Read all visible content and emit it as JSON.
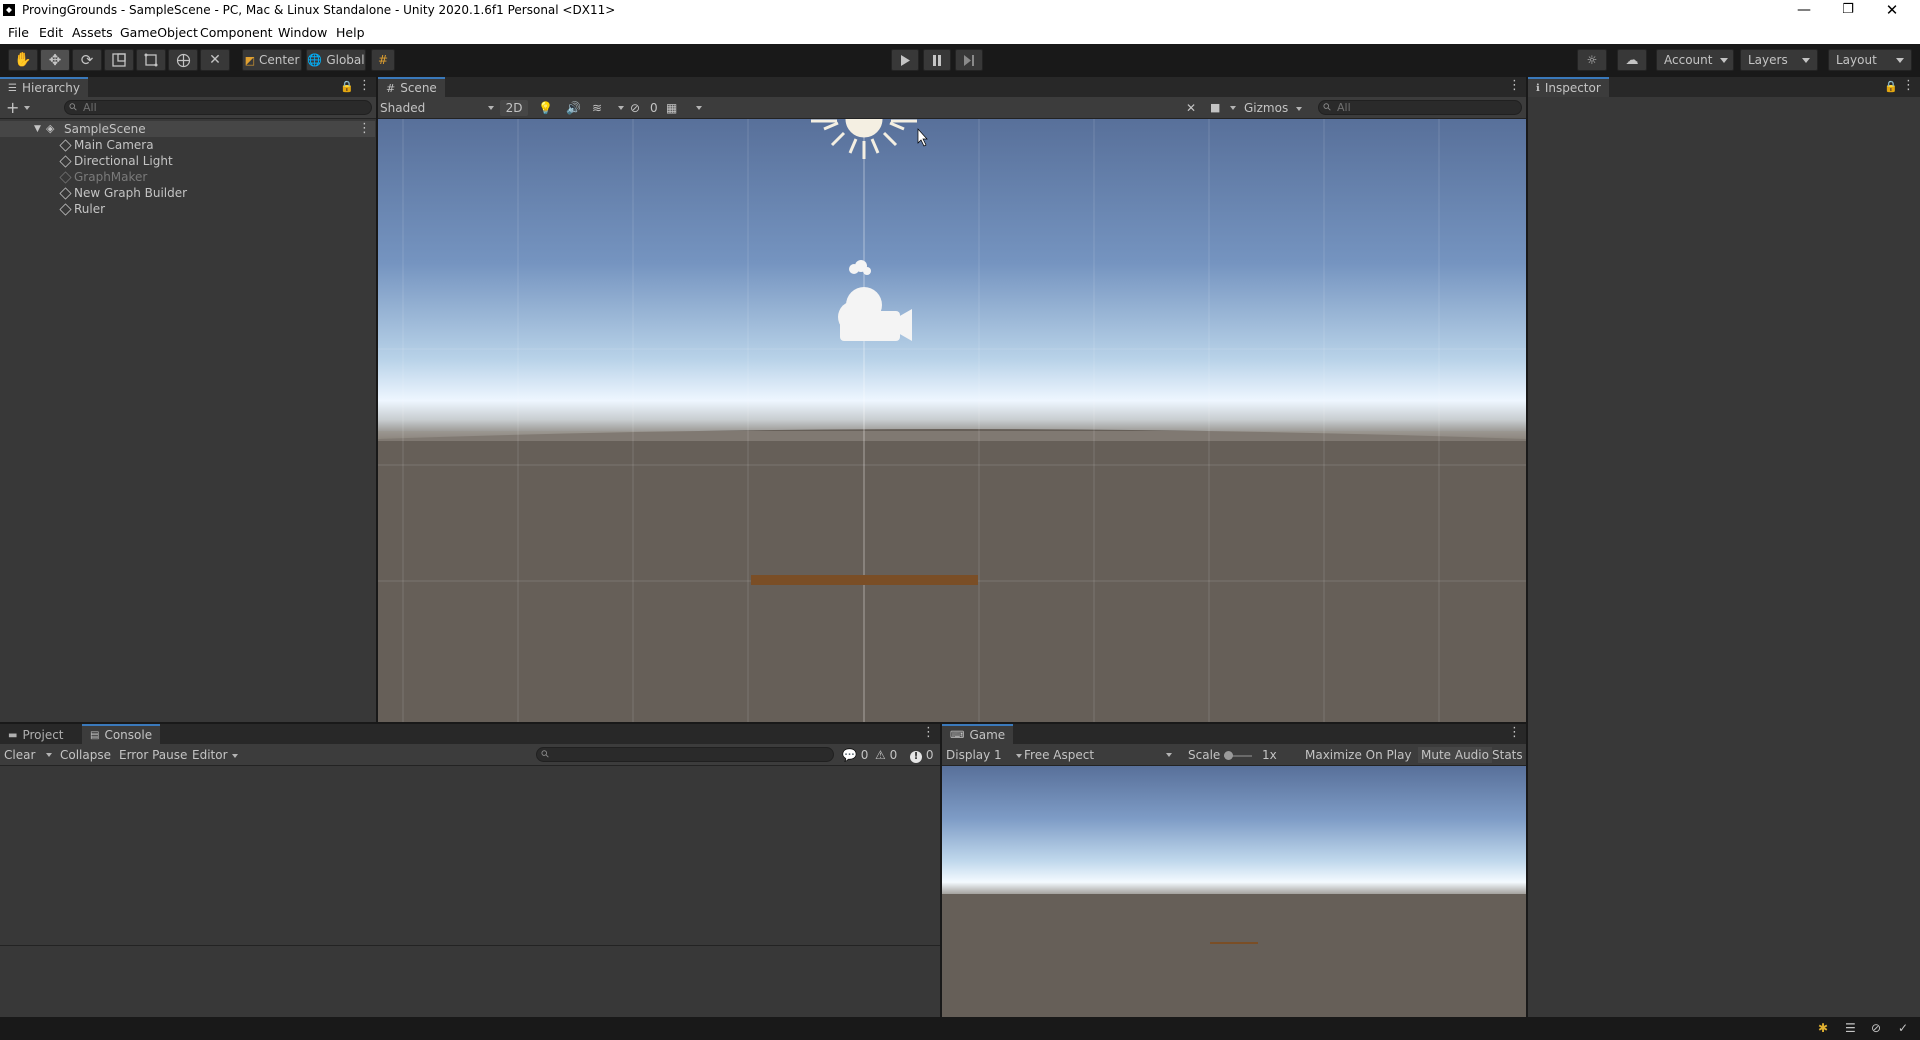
{
  "window": {
    "title": "ProvingGrounds - SampleScene - PC, Mac & Linux Standalone - Unity 2020.1.6f1 Personal <DX11>",
    "minimize": "—",
    "maximize": "❐",
    "close": "✕"
  },
  "menu": [
    "File",
    "Edit",
    "Assets",
    "GameObject",
    "Component",
    "Window",
    "Help"
  ],
  "toolbar": {
    "pivot_mode": "Center",
    "pivot_rotation": "Global",
    "account": "Account",
    "layers": "Layers",
    "layout": "Layout"
  },
  "hierarchy": {
    "tab": "Hierarchy",
    "search_placeholder": "All",
    "scene": "SampleScene",
    "items": [
      {
        "name": "Main Camera",
        "active": true
      },
      {
        "name": "Directional Light",
        "active": true
      },
      {
        "name": "GraphMaker",
        "active": false
      },
      {
        "name": "New Graph Builder",
        "active": true
      },
      {
        "name": "Ruler",
        "active": true
      }
    ]
  },
  "scene": {
    "tab": "Scene",
    "draw_mode": "Shaded",
    "mode_2d": "2D",
    "hidden_count": "0",
    "gizmos": "Gizmos",
    "search_placeholder": "All"
  },
  "inspector": {
    "tab": "Inspector"
  },
  "project_tab": "Project",
  "console": {
    "tab": "Console",
    "clear": "Clear",
    "collapse": "Collapse",
    "error_pause": "Error Pause",
    "editor": "Editor",
    "log_count": "0",
    "warning_count": "0",
    "error_count": "0"
  },
  "game": {
    "tab": "Game",
    "display": "Display 1",
    "aspect": "Free Aspect",
    "scale_label": "Scale",
    "scale_value": "1x",
    "maximize_on_play": "Maximize On Play",
    "mute_audio": "Mute Audio",
    "stats": "Stats"
  },
  "colors": {
    "accent_tab": "#3a79bb",
    "panel": "#383838",
    "ground": "#665f58",
    "plank": "#7a4e26"
  }
}
